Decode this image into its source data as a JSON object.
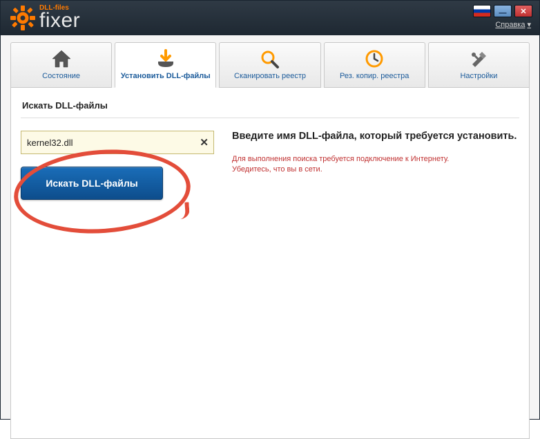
{
  "header": {
    "logo_sub": "DLL-files",
    "logo_main": "fixer",
    "help_label": "Справка"
  },
  "tabs": [
    {
      "label": "Состояние"
    },
    {
      "label": "Установить DLL-файлы"
    },
    {
      "label": "Сканировать реестр"
    },
    {
      "label": "Рез. копир. реестра"
    },
    {
      "label": "Настройки"
    }
  ],
  "section": {
    "title": "Искать DLL-файлы"
  },
  "search": {
    "value": "kernel32.dll",
    "button_label": "Искать DLL-файлы"
  },
  "instructions": {
    "title": "Введите имя DLL-файла, который требуется установить.",
    "warn_line1": "Для выполнения поиска требуется подключение к Интернету.",
    "warn_line2": "Убедитесь, что вы в сети."
  }
}
